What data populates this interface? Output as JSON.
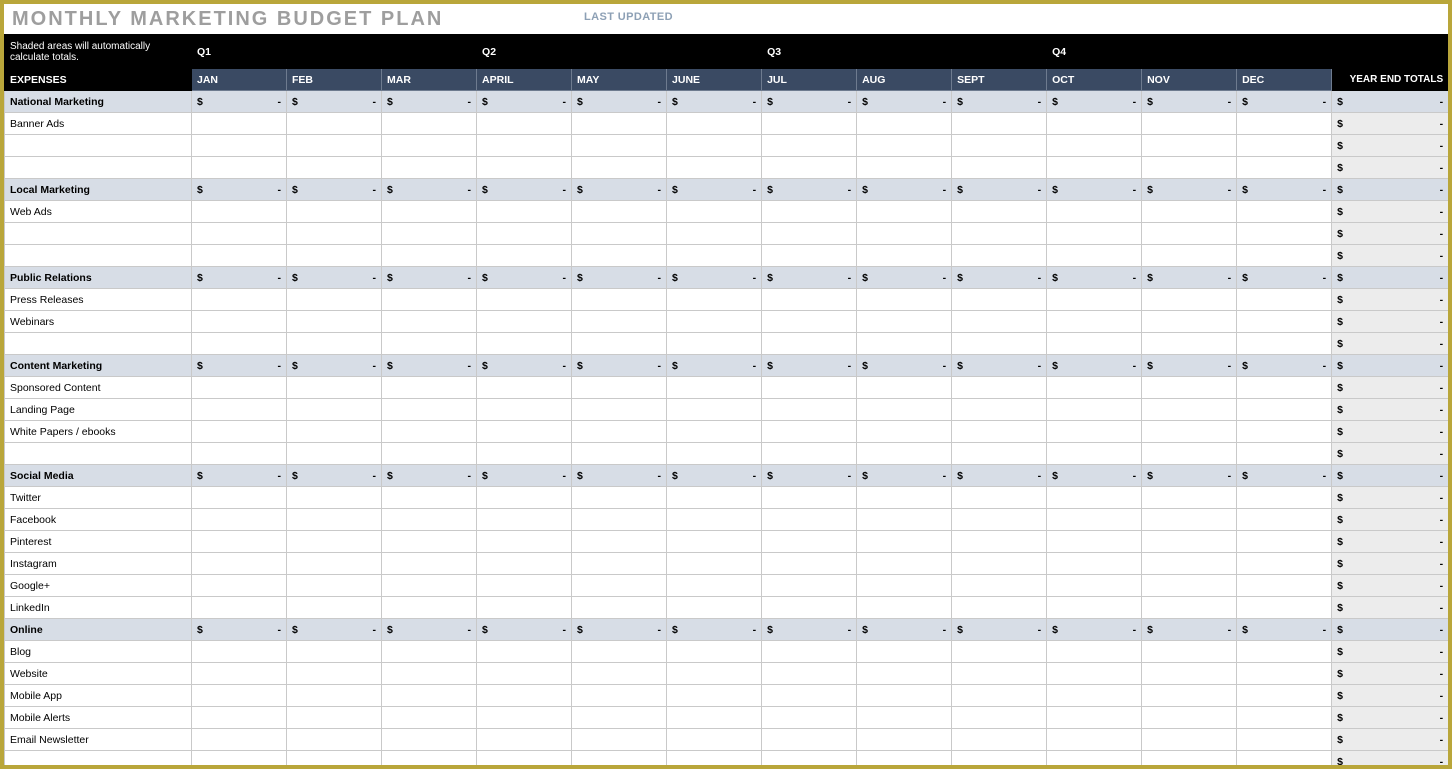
{
  "title": "MONTHLY MARKETING BUDGET PLAN",
  "last_updated_label": "LAST UPDATED",
  "header": {
    "note": "Shaded areas will automatically calculate totals.",
    "expenses": "EXPENSES",
    "total": "YEAR END TOTALS",
    "quarters": [
      "Q1",
      "Q2",
      "Q3",
      "Q4"
    ],
    "months": [
      "JAN",
      "FEB",
      "MAR",
      "APRIL",
      "MAY",
      "JUNE",
      "JUL",
      "AUG",
      "SEPT",
      "OCT",
      "NOV",
      "DEC"
    ]
  },
  "currency": "$",
  "empty": "-",
  "sections": [
    {
      "name": "National Marketing",
      "rows": [
        "Banner Ads",
        "",
        ""
      ]
    },
    {
      "name": "Local Marketing",
      "rows": [
        "Web Ads",
        "",
        ""
      ]
    },
    {
      "name": "Public Relations",
      "rows": [
        "Press Releases",
        "Webinars",
        ""
      ]
    },
    {
      "name": "Content Marketing",
      "rows": [
        "Sponsored Content",
        "Landing Page",
        "White Papers / ebooks",
        ""
      ]
    },
    {
      "name": "Social Media",
      "rows": [
        "Twitter",
        "Facebook",
        "Pinterest",
        "Instagram",
        "Google+",
        "LinkedIn"
      ]
    },
    {
      "name": "Online",
      "rows": [
        "Blog",
        "Website",
        "Mobile App",
        "Mobile Alerts",
        "Email Newsletter",
        ""
      ]
    }
  ]
}
